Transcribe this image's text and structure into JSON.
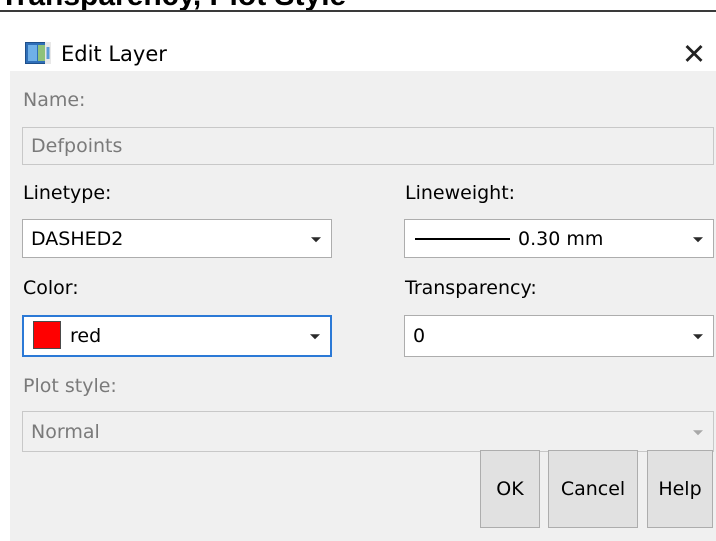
{
  "background_heading": "Transparency, Plot Style",
  "window": {
    "title": "Edit Layer",
    "icon": "layers-app-icon",
    "close_glyph": "✕"
  },
  "name": {
    "label": "Name:",
    "value": "Defpoints"
  },
  "linetype": {
    "label": "Linetype:",
    "value": "DASHED2"
  },
  "lineweight": {
    "label": "Lineweight:",
    "value": "0.30 mm"
  },
  "color": {
    "label": "Color:",
    "value": "red",
    "swatch": "#ff0000"
  },
  "transparency": {
    "label": "Transparency:",
    "value": "0"
  },
  "plot_style": {
    "label": "Plot style:",
    "value": "Normal"
  },
  "buttons": {
    "ok": "OK",
    "cancel": "Cancel",
    "help": "Help"
  }
}
